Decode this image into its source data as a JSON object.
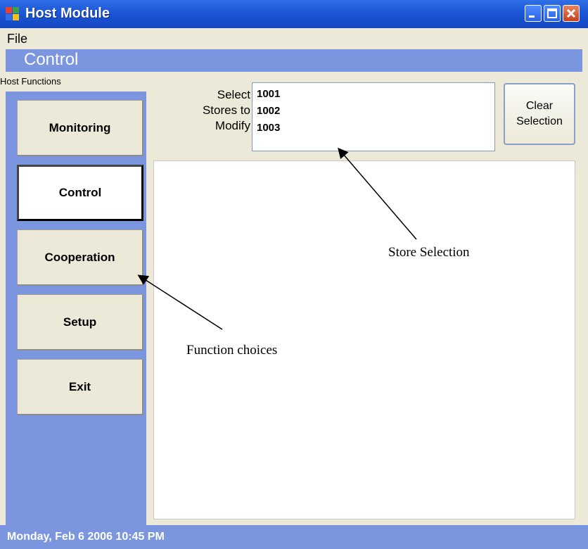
{
  "window": {
    "title": "Host Module"
  },
  "menu": {
    "file": "File"
  },
  "section": {
    "title": "Control",
    "panel_caption": "Host Functions"
  },
  "functions": [
    "Monitoring",
    "Control",
    "Cooperation",
    "Setup",
    "Exit"
  ],
  "active_function": "Control",
  "store_selector": {
    "label_lines": [
      "Select",
      "Stores to",
      "Modify"
    ],
    "stores": [
      "1001",
      "1002",
      "1003"
    ]
  },
  "clear_button": {
    "label_lines": [
      "Clear",
      "Selection"
    ]
  },
  "status": {
    "datetime": "Monday, Feb 6 2006 10:45 PM"
  },
  "annotations": {
    "store_selection": "Store Selection",
    "function_choices": "Function choices"
  },
  "colors": {
    "titlebar": "#1c56d6",
    "panel_blue": "#7b96de",
    "window_bg": "#ece9d8"
  }
}
